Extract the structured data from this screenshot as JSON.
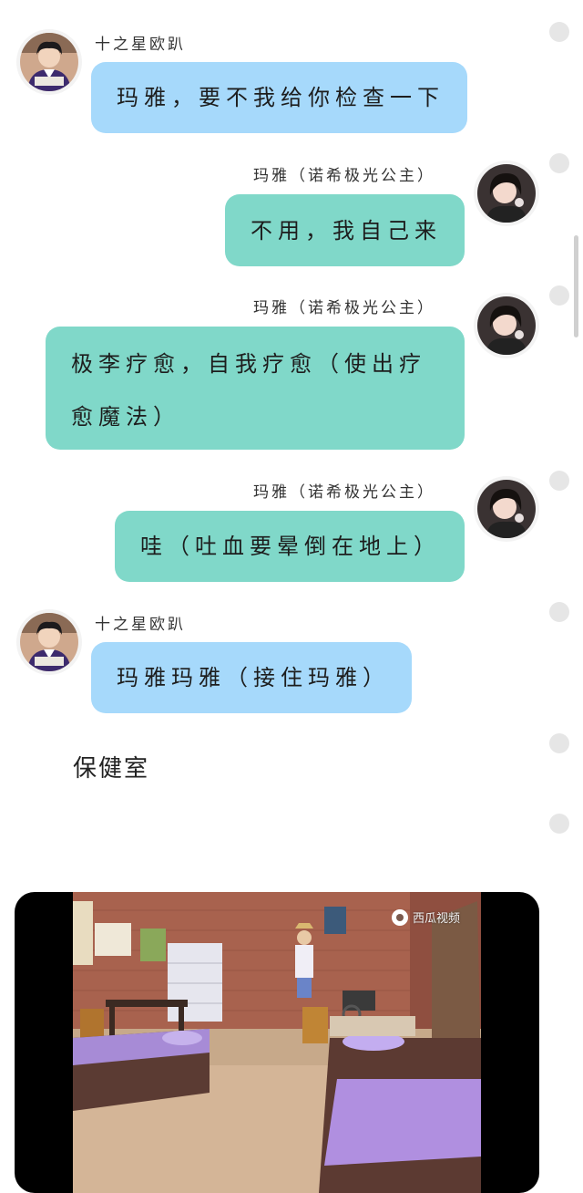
{
  "messages": [
    {
      "sender": "十之星欧趴",
      "side": "left",
      "color": "blue",
      "text": "玛雅，要不我给你检查一下"
    },
    {
      "sender": "玛雅（诺希极光公主）",
      "side": "right",
      "color": "teal",
      "text": "不用，我自己来"
    },
    {
      "sender": "玛雅（诺希极光公主）",
      "side": "right",
      "color": "teal",
      "text": "极李疗愈，自我疗愈（使出疗愈魔法）"
    },
    {
      "sender": "玛雅（诺希极光公主）",
      "side": "right",
      "color": "teal",
      "text": "哇（吐血要晕倒在地上）"
    },
    {
      "sender": "十之星欧趴",
      "side": "left",
      "color": "blue",
      "text": "玛雅玛雅（接住玛雅）"
    }
  ],
  "caption": "保健室",
  "video": {
    "watermark": "西瓜视频",
    "watermark_icon": "xigua-logo-icon"
  },
  "colors": {
    "blue_bubble": "#a6d9fb",
    "teal_bubble": "#80d8c9",
    "background": "#ffffff"
  }
}
